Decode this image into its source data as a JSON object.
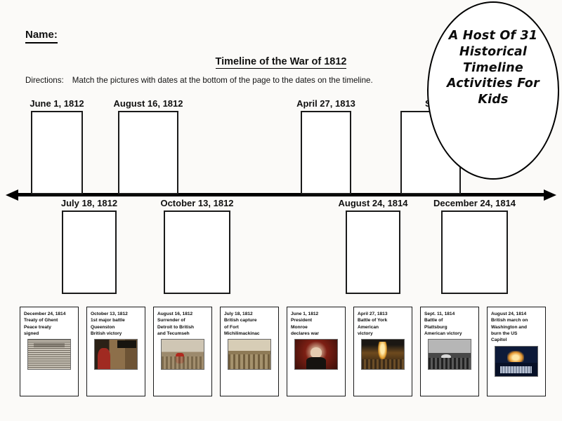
{
  "header": {
    "name_label": "Name:",
    "title": "Timeline of the War of 1812",
    "directions_label": "Directions:",
    "directions_text": "Match the pictures with dates at the bottom of the page to the dates on the timeline."
  },
  "badge": {
    "line1": "A Host Of 31",
    "line2": "Historical",
    "line3": "Timeline",
    "line4": "Activities For",
    "line5": "Kids"
  },
  "timeline": {
    "top_slots": [
      {
        "date": "June 1, 1812"
      },
      {
        "date": "August 16, 1812"
      },
      {
        "date": "April 27, 1813"
      },
      {
        "date": "Se"
      }
    ],
    "bottom_slots": [
      {
        "date": "July 18, 1812"
      },
      {
        "date": "October 13, 1812"
      },
      {
        "date": "August 24, 1814"
      },
      {
        "date": "December 24, 1814"
      }
    ]
  },
  "cards": [
    {
      "date": "December 24, 1814",
      "line2": "Treaty of Ghent",
      "line3": "Peace treaty",
      "line4": "signed",
      "image_name": "treaty-of-ghent-document"
    },
    {
      "date": "October 13, 1812",
      "line2": "1st major battle",
      "line3": "Queenston",
      "line4": "British victory",
      "image_name": "queenston-portrait"
    },
    {
      "date": "August 16, 1812",
      "line2": "Surrender of",
      "line3": "Detroit to British",
      "line4": "and Tecumseh",
      "image_name": "surrender-of-detroit-painting"
    },
    {
      "date": "July 18, 1812",
      "line2": "British capture",
      "line3": "of Fort",
      "line4": "Michilimackinac",
      "image_name": "fort-michilimackinac-painting"
    },
    {
      "date": "June 1, 1812",
      "line2": "President",
      "line3": "Monroe",
      "line4": "declares war",
      "image_name": "president-portrait"
    },
    {
      "date": "April 27, 1813",
      "line2": "Battle of York",
      "line3": "American",
      "line4": "victory",
      "image_name": "battle-of-york-painting"
    },
    {
      "date": "Sept. 11, 1814",
      "line2": "Battle of",
      "line3": "Plattsburg",
      "line4": "American victory",
      "image_name": "battle-of-plattsburg-engraving"
    },
    {
      "date": "August 24, 1814",
      "line2": "British march on",
      "line3": "Washington and",
      "line4": "burn the US",
      "line5": "Capitol",
      "image_name": "burning-of-washington-painting"
    }
  ],
  "colors": {
    "ink": "#111111",
    "paper": "#fbfaf8",
    "box_border": "#1a1a1a"
  }
}
